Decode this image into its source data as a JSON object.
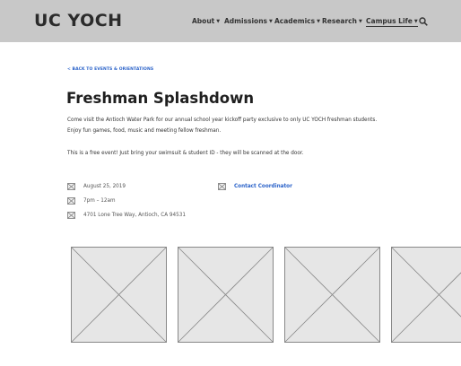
{
  "header": {
    "logo": "UC YOCH",
    "nav": [
      {
        "label": "About"
      },
      {
        "label": "Admissions"
      },
      {
        "label": "Academics"
      },
      {
        "label": "Research"
      },
      {
        "label": "Campus Life"
      }
    ],
    "search_icon": "search-icon"
  },
  "breadcrumb": "< BACK TO EVENTS & ORIENTATIONS",
  "event": {
    "title": "Freshman Splashdown",
    "description_line1": "Come visit the Antioch Water Park for our annual school year kickoff party exclusive to only UC YOCH freshman students.",
    "description_line2": "Enjoy fun games, food, music and meeting fellow freshman.",
    "note": "This is a free event! Just bring your swimsuit & student ID - they will be scanned at the door.",
    "date": "August 25, 2019",
    "time": "7pm – 12am",
    "address": "4701 Lone Tree Way, Antioch, CA 94531",
    "contact": "Contact Coordinator"
  },
  "gallery": {
    "image_icon": "image-placeholder-icon",
    "count": 4
  }
}
